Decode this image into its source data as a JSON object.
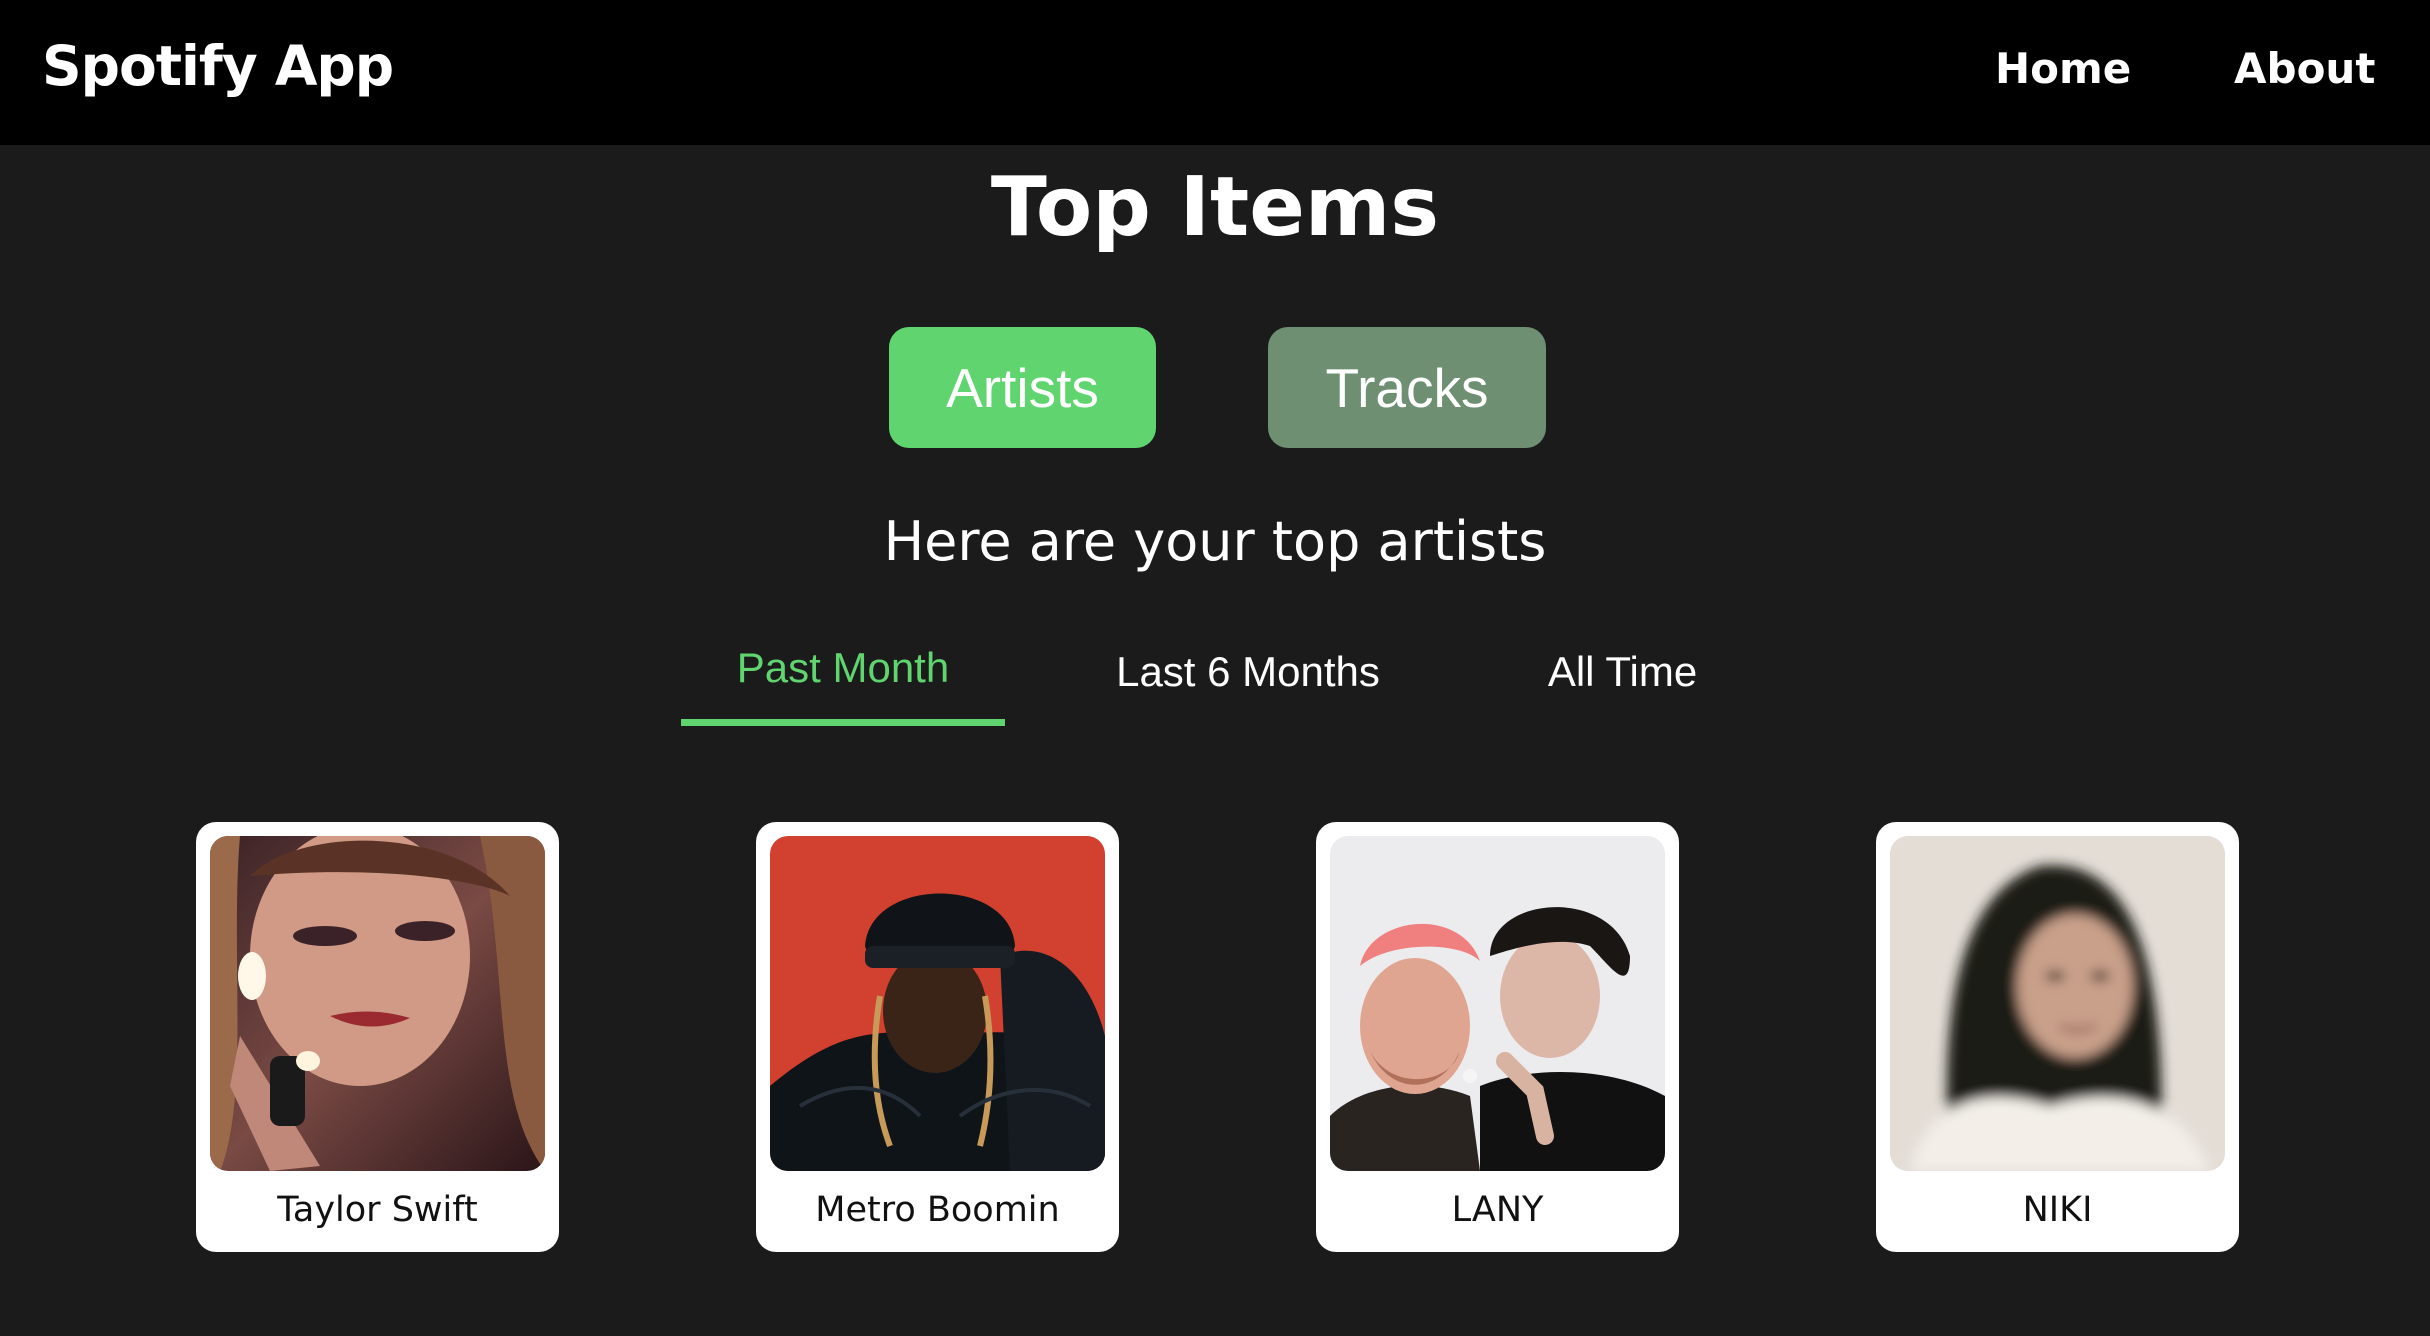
{
  "navbar": {
    "brand": "Spotify App",
    "links": [
      {
        "label": "Home"
      },
      {
        "label": "About"
      }
    ]
  },
  "page": {
    "title": "Top Items",
    "subtitle": "Here are your top artists"
  },
  "toggle": {
    "artists_label": "Artists",
    "tracks_label": "Tracks",
    "selected": "Artists"
  },
  "time_ranges": {
    "tabs": [
      {
        "label": "Past Month"
      },
      {
        "label": "Last 6 Months"
      },
      {
        "label": "All Time"
      }
    ],
    "selected": "Past Month"
  },
  "artists": [
    {
      "name": "Taylor Swift",
      "photo": "artist-photo"
    },
    {
      "name": "Metro Boomin",
      "photo": "artist-photo"
    },
    {
      "name": "LANY",
      "photo": "artist-photo"
    },
    {
      "name": "NIKI",
      "photo": "artist-photo"
    }
  ],
  "colors": {
    "background": "#1b1b1b",
    "navbar": "#000000",
    "accent_green": "#5fd46f",
    "muted_green": "#6e8f72",
    "card": "#ffffff"
  }
}
